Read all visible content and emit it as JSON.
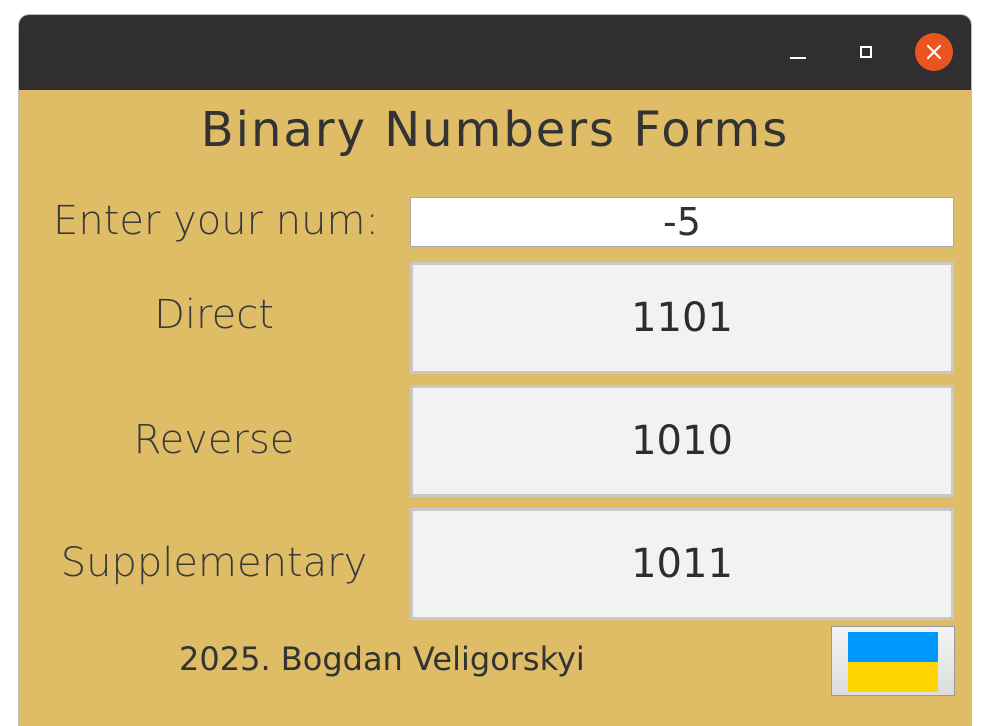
{
  "window": {
    "titlebar_color": "#302e30",
    "close_color": "#e95420",
    "background_color": "#dfbd67",
    "controls": [
      "minimize-icon",
      "maximize-icon",
      "close-icon"
    ]
  },
  "main": {
    "title": "Binary Numbers Forms",
    "input_label": "Enter your num:",
    "input_value": "-5",
    "rows": [
      {
        "label": "Direct",
        "value": "1101"
      },
      {
        "label": "Reverse",
        "value": "1010"
      },
      {
        "label": "Supplementary",
        "value": "1011"
      }
    ]
  },
  "footer": {
    "credit": "2025. Bogdan Veligorskyi",
    "flag_icon": "ukraine-flag-icon",
    "flag_colors": [
      "#0197fd",
      "#ffd500"
    ]
  }
}
